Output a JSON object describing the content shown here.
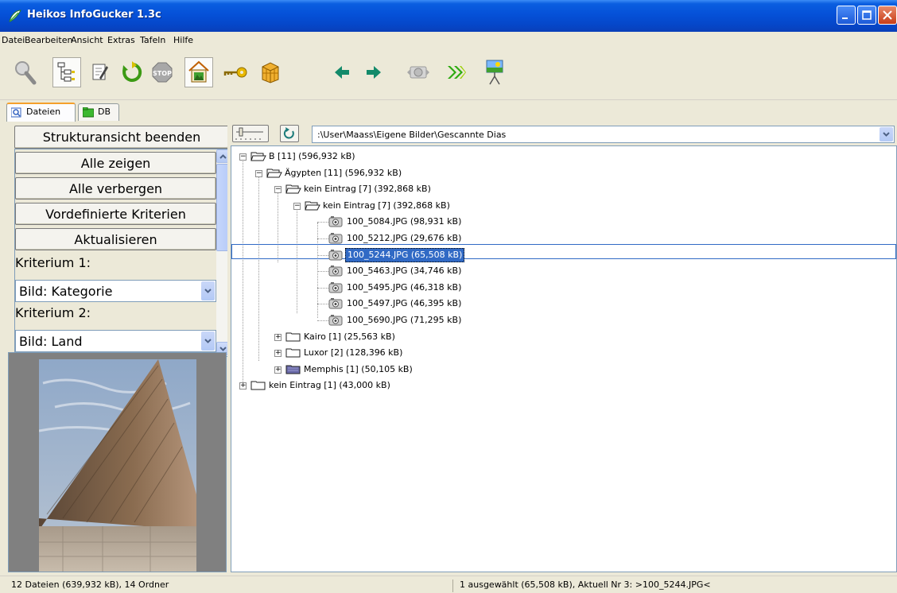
{
  "window": {
    "title": "Heikos InfoGucker 1.3c"
  },
  "menu": [
    "Datei",
    "Bearbeiten",
    "Ansicht",
    "Extras",
    "Tafeln",
    "Hilfe"
  ],
  "toolbar": {
    "buttons": [
      "search-icon",
      "tree-view-icon",
      "edit-icon",
      "refresh-icon",
      "stop-icon",
      "home-picture-icon",
      "key-icon",
      "box-icon",
      "arrow-left-icon",
      "arrow-right-icon",
      "camera-icon",
      "fast-forward-icon",
      "slideshow-icon"
    ]
  },
  "tabs": [
    {
      "label": "Dateien",
      "active": true
    },
    {
      "label": "DB",
      "active": false
    }
  ],
  "left": {
    "structure_button": "Strukturansicht beenden",
    "show_all": "Alle zeigen",
    "hide_all": "Alle verbergen",
    "predefined": "Vordefinierte Kriterien",
    "update": "Aktualisieren",
    "criterion1_label": "Kriterium 1:",
    "criterion1_value": "Bild: Kategorie",
    "criterion2_label": "Kriterium 2:",
    "criterion2_value": "Bild: Land"
  },
  "path": {
    "value": ":\\User\\Maass\\Eigene Bilder\\Gescannte Dias"
  },
  "tree": [
    {
      "label": "B [11] (596,932 kB)",
      "level": 0,
      "type": "folder-open",
      "expander": "minus"
    },
    {
      "label": "Ägypten [11] (596,932 kB)",
      "level": 1,
      "type": "folder-open",
      "expander": "minus"
    },
    {
      "label": "kein Eintrag [7] (392,868 kB)",
      "level": 2,
      "type": "folder-open",
      "expander": "minus"
    },
    {
      "label": "kein Eintrag [7] (392,868 kB)",
      "level": 3,
      "type": "folder-open",
      "expander": "minus"
    },
    {
      "label": "100_5084.JPG (98,931 kB)",
      "level": 4,
      "type": "camera"
    },
    {
      "label": "100_5212.JPG (29,676 kB)",
      "level": 4,
      "type": "camera"
    },
    {
      "label": "100_5244.JPG (65,508 kB)",
      "level": 4,
      "type": "camera",
      "selected": true
    },
    {
      "label": "100_5463.JPG (34,746 kB)",
      "level": 4,
      "type": "camera"
    },
    {
      "label": "100_5495.JPG (46,318 kB)",
      "level": 4,
      "type": "camera"
    },
    {
      "label": "100_5497.JPG (46,395 kB)",
      "level": 4,
      "type": "camera"
    },
    {
      "label": "100_5690.JPG (71,295 kB)",
      "level": 4,
      "type": "camera"
    },
    {
      "label": "Kairo [1] (25,563 kB)",
      "level": 2,
      "type": "folder",
      "expander": "plus"
    },
    {
      "label": "Luxor [2] (128,396 kB)",
      "level": 2,
      "type": "folder",
      "expander": "plus"
    },
    {
      "label": "Memphis [1] (50,105 kB)",
      "level": 2,
      "type": "folder-purple",
      "expander": "plus"
    },
    {
      "label": "kein Eintrag [1] (43,000 kB)",
      "level": 0,
      "type": "folder",
      "expander": "plus"
    }
  ],
  "status": {
    "left": "12 Dateien (639,932 kB), 14 Ordner",
    "right": "1 ausgewählt (65,508 kB), Aktuell Nr 3: >100_5244.JPG<"
  },
  "colors": {
    "titlebar": "#0551d8",
    "selection": "#316ac5",
    "face": "#ece9d8"
  }
}
